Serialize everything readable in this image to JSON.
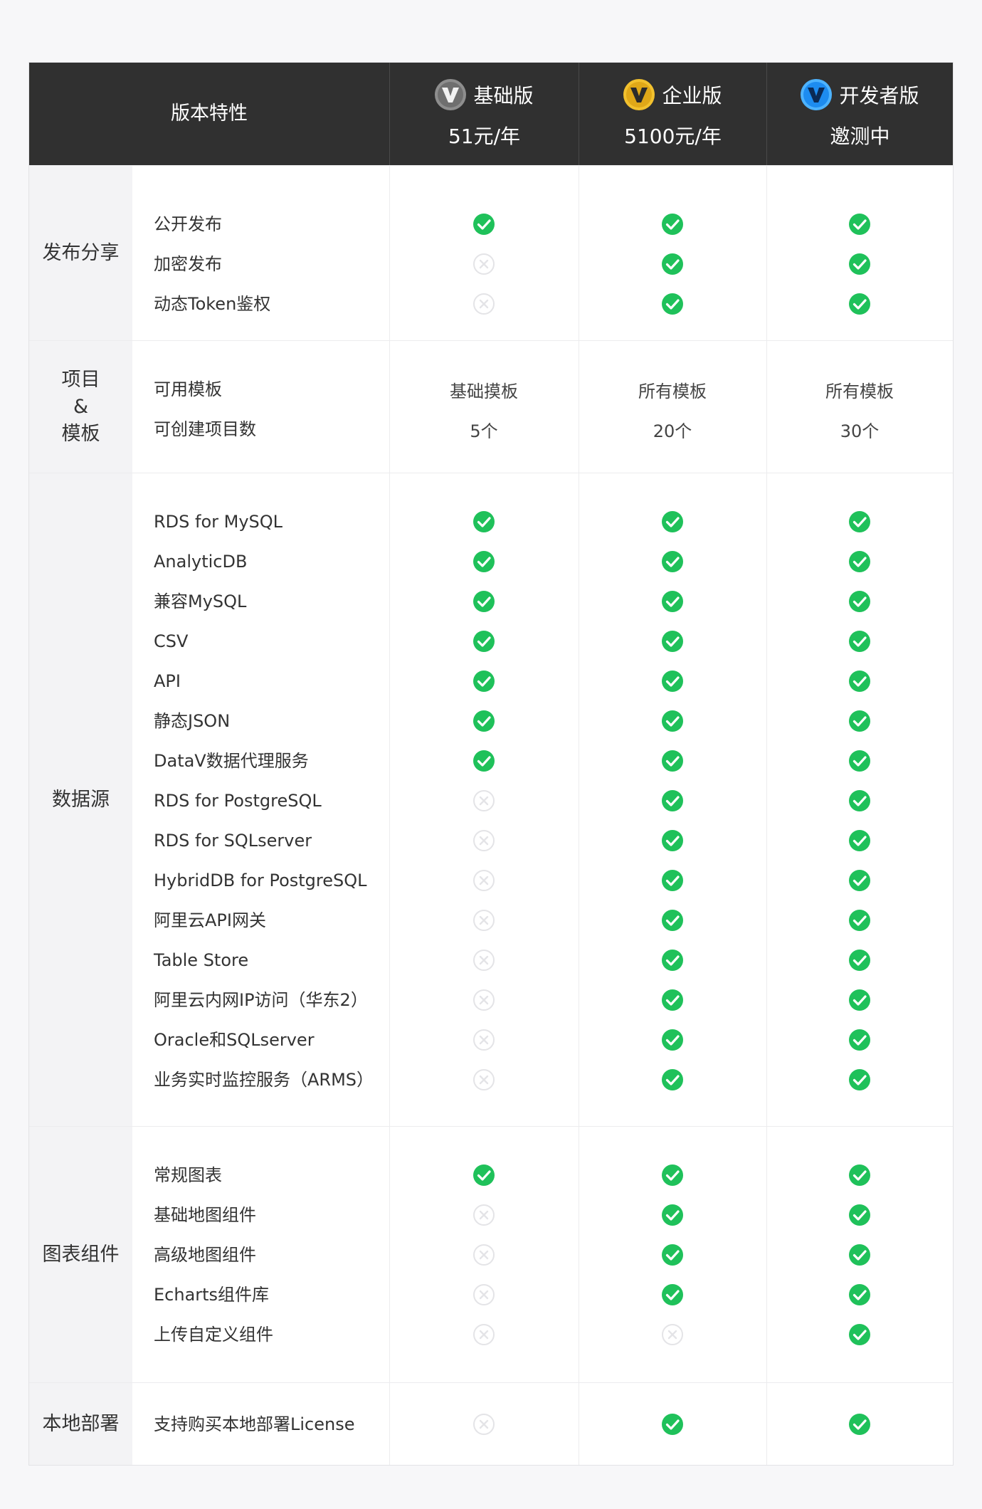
{
  "header": {
    "features_label": "版本特性",
    "plans": [
      {
        "name": "基础版",
        "price": "51元/年",
        "icon": "datav-logo-grey",
        "color": "#8e8e8e"
      },
      {
        "name": "企业版",
        "price": "5100元/年",
        "icon": "datav-logo-gold",
        "color": "#e0a818"
      },
      {
        "name": "开发者版",
        "price": "邀测中",
        "icon": "datav-logo-blue",
        "color": "#1d8cf0"
      }
    ]
  },
  "colors": {
    "check": "#1fc15a",
    "cross": "#e4e4e7",
    "header_bg": "#303030"
  },
  "sections": [
    {
      "label": "发布分享",
      "rows": [
        {
          "feature": "公开发布",
          "values": [
            "check",
            "check",
            "check"
          ]
        },
        {
          "feature": "加密发布",
          "values": [
            "cross",
            "check",
            "check"
          ]
        },
        {
          "feature": "动态Token鉴权",
          "values": [
            "cross",
            "check",
            "check"
          ]
        }
      ]
    },
    {
      "label_lines": [
        "项目",
        "&",
        "模板"
      ],
      "rows": [
        {
          "feature": "可用模板",
          "values": [
            "基础摸板",
            "所有模板",
            "所有模板"
          ]
        },
        {
          "feature": "可创建项目数",
          "values": [
            "5个",
            "20个",
            "30个"
          ]
        }
      ]
    },
    {
      "label": "数据源",
      "rows": [
        {
          "feature": "RDS for MySQL",
          "values": [
            "check",
            "check",
            "check"
          ]
        },
        {
          "feature": "AnalyticDB",
          "values": [
            "check",
            "check",
            "check"
          ]
        },
        {
          "feature": "兼容MySQL",
          "values": [
            "check",
            "check",
            "check"
          ]
        },
        {
          "feature": "CSV",
          "values": [
            "check",
            "check",
            "check"
          ]
        },
        {
          "feature": "API",
          "values": [
            "check",
            "check",
            "check"
          ]
        },
        {
          "feature": "静态JSON",
          "values": [
            "check",
            "check",
            "check"
          ]
        },
        {
          "feature": "DataV数据代理服务",
          "values": [
            "check",
            "check",
            "check"
          ]
        },
        {
          "feature": "RDS for PostgreSQL",
          "values": [
            "cross",
            "check",
            "check"
          ]
        },
        {
          "feature": "RDS for SQLserver",
          "values": [
            "cross",
            "check",
            "check"
          ]
        },
        {
          "feature": "HybridDB for PostgreSQL",
          "values": [
            "cross",
            "check",
            "check"
          ]
        },
        {
          "feature": "阿里云API网关",
          "values": [
            "cross",
            "check",
            "check"
          ]
        },
        {
          "feature": "Table Store",
          "values": [
            "cross",
            "check",
            "check"
          ]
        },
        {
          "feature": "阿里云内网IP访问（华东2）",
          "values": [
            "cross",
            "check",
            "check"
          ]
        },
        {
          "feature": "Oracle和SQLserver",
          "values": [
            "cross",
            "check",
            "check"
          ]
        },
        {
          "feature": "业务实时监控服务（ARMS）",
          "values": [
            "cross",
            "check",
            "check"
          ]
        }
      ]
    },
    {
      "label": "图表组件",
      "rows": [
        {
          "feature": "常规图表",
          "values": [
            "check",
            "check",
            "check"
          ]
        },
        {
          "feature": "基础地图组件",
          "values": [
            "cross",
            "check",
            "check"
          ]
        },
        {
          "feature": "高级地图组件",
          "values": [
            "cross",
            "check",
            "check"
          ]
        },
        {
          "feature": "Echarts组件库",
          "values": [
            "cross",
            "check",
            "check"
          ]
        },
        {
          "feature": "上传自定义组件",
          "values": [
            "cross",
            "cross",
            "check"
          ]
        }
      ]
    },
    {
      "label": "本地部署",
      "rows": [
        {
          "feature": "支持购买本地部署License",
          "values": [
            "cross",
            "check",
            "check"
          ]
        }
      ]
    }
  ]
}
